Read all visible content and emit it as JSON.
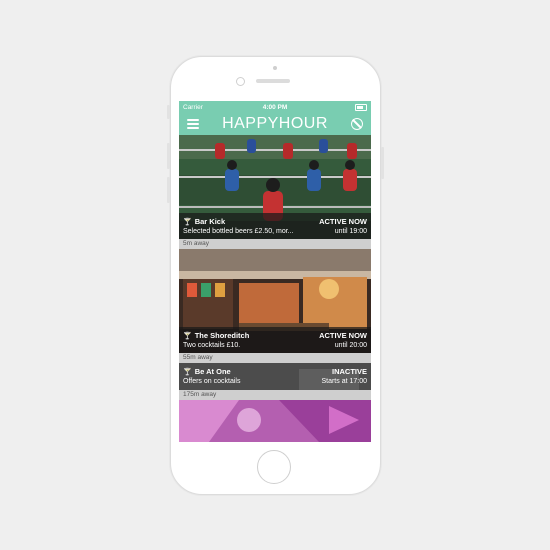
{
  "status_bar": {
    "carrier": "Carrier",
    "time": "4:00 PM"
  },
  "nav": {
    "title": "HAPPYHOUR",
    "menu_icon": "hamburger-icon",
    "filter_icon": "no-entry-icon"
  },
  "bars": [
    {
      "name": "Bar Kick",
      "status": "ACTIVE NOW",
      "offer": "Selected bottled beers £2.50, mor...",
      "until": "until 19:00",
      "distance": "5m away"
    },
    {
      "name": "The Shoreditch",
      "status": "ACTIVE NOW",
      "offer": "Two cocktails £10.",
      "until": "until 20:00",
      "distance": "55m away"
    },
    {
      "name": "Be At One",
      "status": "INACTIVE",
      "offer": "Offers on cocktails",
      "until": "Starts at 17:00",
      "distance": "175m away"
    }
  ],
  "colors": {
    "accent": "#79cdb1",
    "overlay": "#191919",
    "distance_bg": "#cfcfcf"
  }
}
